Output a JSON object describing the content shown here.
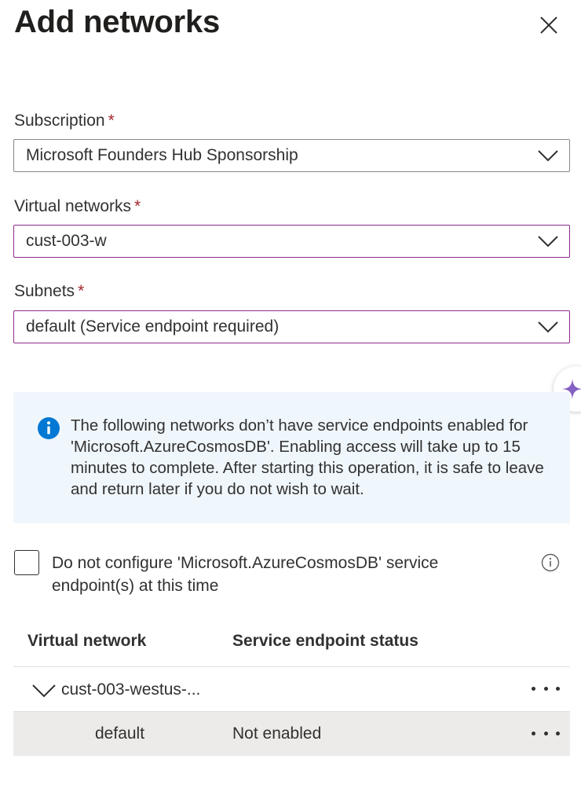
{
  "panel": {
    "title": "Add networks",
    "close_icon": "close-icon"
  },
  "form": {
    "subscription": {
      "label": "Subscription",
      "required_mark": "*",
      "value": "Microsoft Founders Hub Sponsorship"
    },
    "virtual_networks": {
      "label": "Virtual networks",
      "required_mark": "*",
      "value": "cust-003-w"
    },
    "subnets": {
      "label": "Subnets",
      "required_mark": "*",
      "value": "default (Service endpoint required)"
    }
  },
  "info_message": "The following networks don’t have service endpoints enabled for 'Microsoft.AzureCosmosDB'. Enabling access will take up to 15 minutes to complete. After starting this operation, it is safe to leave and return later if you do not wish to wait.",
  "checkbox": {
    "checked": false,
    "label": "Do not configure 'Microsoft.AzureCosmosDB' service endpoint(s) at this time"
  },
  "table": {
    "columns": [
      "Virtual network",
      "Service endpoint status"
    ],
    "rows": [
      {
        "name": "cust-003-westus-...",
        "status": "",
        "expanded": true
      },
      {
        "name": "default",
        "status": "Not enabled",
        "selected": true
      }
    ]
  },
  "colors": {
    "accent_focus": "#8c2d8c",
    "required": "#a4262c",
    "info_background": "#eff6fc",
    "info_icon": "#0078d4",
    "copilot": "#8661c5",
    "selected_row": "#edebe9"
  }
}
